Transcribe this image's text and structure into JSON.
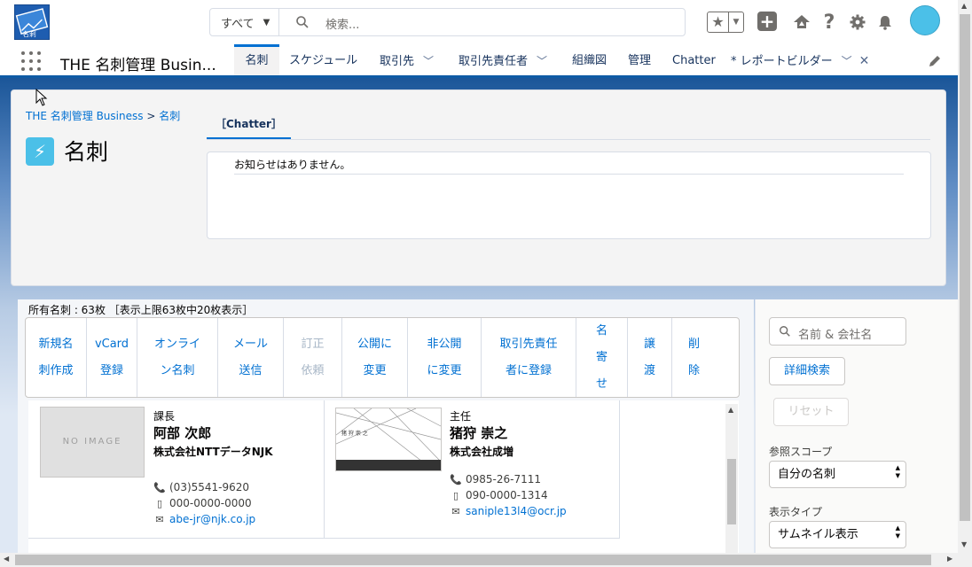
{
  "header": {
    "search_scope": "すべて",
    "search_placeholder": "検索...",
    "app_name": "THE 名刺管理 Busin..."
  },
  "nav": {
    "tabs": [
      {
        "label": "名刺",
        "active": true
      },
      {
        "label": "スケジュール"
      },
      {
        "label": "取引先",
        "dropdown": true
      },
      {
        "label": "取引先責任者",
        "dropdown": true
      },
      {
        "label": "組織図"
      },
      {
        "label": "管理"
      },
      {
        "label": "Chatter"
      },
      {
        "label": "* レポートビルダー",
        "dropdown": true,
        "closable": true
      }
    ]
  },
  "page": {
    "breadcrumb_root": "THE 名刺管理 Business",
    "breadcrumb_sep": ">",
    "breadcrumb_current": "名刺",
    "title": "名刺",
    "chatter_tab": "［Chatter］",
    "notice": "お知らせはありません。"
  },
  "list": {
    "count_label": "所有名刺 : 63枚 ［表示上限63枚中20枚表示］",
    "actions": [
      {
        "line1": "新規名",
        "line2": "刺作成"
      },
      {
        "line1": "vCard",
        "line2": "登録"
      },
      {
        "line1": "オンライ",
        "line2": "ン名刺"
      },
      {
        "line1": "メール",
        "line2": "送信"
      },
      {
        "line1": "訂正",
        "line2": "依頼",
        "disabled": true
      },
      {
        "line1": "公開に",
        "line2": "変更"
      },
      {
        "line1": "非公開",
        "line2": "に変更"
      },
      {
        "line1": "取引先責任",
        "line2": "者に登録"
      },
      {
        "line1": "名",
        "line2": "寄",
        "line3": "せ"
      },
      {
        "line1": "譲",
        "line2": "渡"
      },
      {
        "line1": "削",
        "line2": "除"
      }
    ],
    "cards": [
      {
        "image": "NO IMAGE",
        "title": "課長",
        "name": "阿部 次郎",
        "company": "株式会社NTTデータNJK",
        "phone": "(03)5541-9620",
        "mobile": "000-0000-0000",
        "email": "abe-jr@njk.co.jp"
      },
      {
        "image_card_text": "猪 狩 崇 之",
        "title": "主任",
        "name": "猪狩 崇之",
        "company": "株式会社成増",
        "phone": "0985-26-7111",
        "mobile": "090-0000-1314",
        "email": "saniple13l4@ocr.jp"
      }
    ]
  },
  "filter": {
    "search_placeholder": "名前 & 会社名",
    "advanced_search": "詳細検索",
    "reset": "リセット",
    "scope_label": "参照スコープ",
    "scope_value": "自分の名刺",
    "view_label": "表示タイプ",
    "view_value": "サムネイル表示"
  },
  "colors": {
    "brand_blue": "#0070d2",
    "nav_border": "#0e5ba5",
    "object_icon": "#4bc0e8"
  },
  "icons": [
    "app-logo-icon",
    "search-icon",
    "favorites-icon",
    "add-icon",
    "trailhead-icon",
    "help-icon",
    "setup-gear-icon",
    "notification-bell-icon",
    "app-launcher-icon",
    "edit-pencil-icon",
    "lightning-bolt-icon",
    "phone-icon",
    "mobile-icon",
    "email-icon"
  ]
}
